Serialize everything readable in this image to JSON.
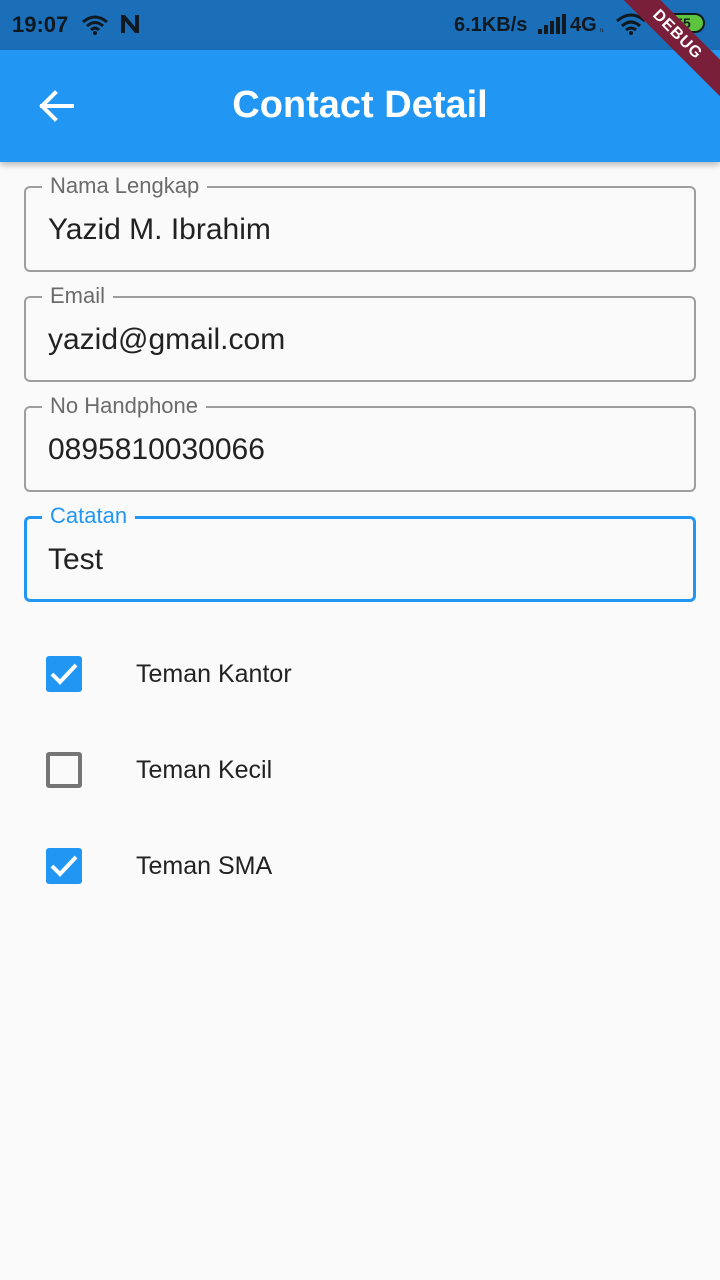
{
  "status_bar": {
    "time": "19:07",
    "speed": "6.1KB/s",
    "network": "4G",
    "network_sub": "ₗₜ",
    "battery": "55",
    "debug_label": "DEBUG"
  },
  "app_bar": {
    "title": "Contact Detail",
    "back_icon": "arrow-back-icon"
  },
  "form": {
    "fields": [
      {
        "label": "Nama Lengkap",
        "value": "Yazid M. Ibrahim"
      },
      {
        "label": "Email",
        "value": "yazid@gmail.com"
      },
      {
        "label": "No Handphone",
        "value": "0895810030066"
      },
      {
        "label": "Catatan",
        "value": "Test"
      }
    ],
    "checkboxes": [
      {
        "label": "Teman Kantor",
        "checked": true
      },
      {
        "label": "Teman Kecil",
        "checked": false
      },
      {
        "label": "Teman SMA",
        "checked": true
      }
    ]
  },
  "colors": {
    "primary": "#2196f3",
    "status_bar": "#1a6fb8",
    "debug_ribbon": "#7a1f3a",
    "battery": "#5cc43d"
  }
}
